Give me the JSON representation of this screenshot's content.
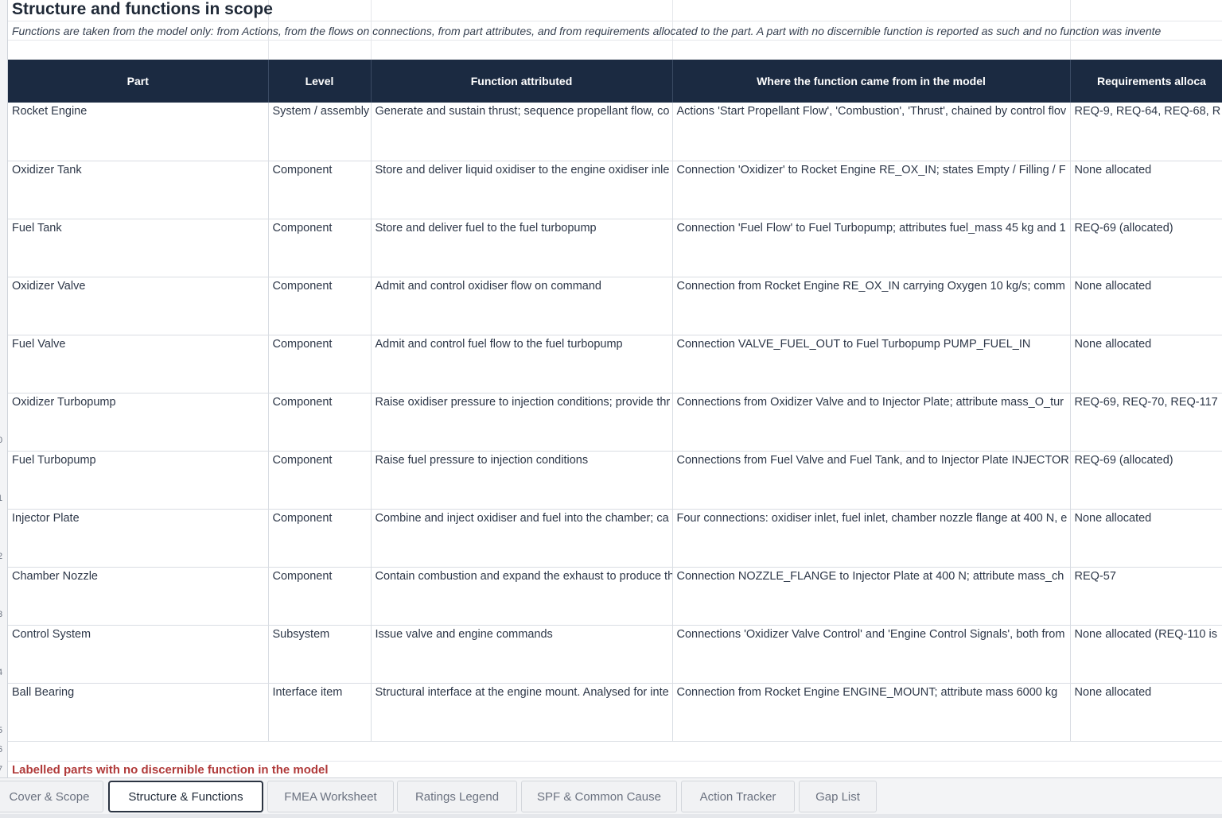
{
  "sheet": {
    "title": "Structure and functions in scope",
    "subtitle": "Functions are taken from the model only: from Actions, from the flows on connections, from part attributes, and from requirements allocated to the part. A part with no discernible function is reported as such and no function was invente",
    "row_numbers": [
      "0",
      "1",
      "2",
      "3",
      "4",
      "5",
      "6",
      "7"
    ],
    "columns": [
      "Part",
      "Level",
      "Function attributed",
      "Where the function came from in the model",
      "Requirements alloca"
    ],
    "rows": [
      [
        "Rocket Engine",
        "System / assembly",
        "Generate and sustain thrust; sequence propellant flow, co",
        "Actions 'Start Propellant Flow', 'Combustion', 'Thrust', chained by control flov",
        "REQ-9, REQ-64, REQ-68, R"
      ],
      [
        "Oxidizer Tank",
        "Component",
        "Store and deliver liquid oxidiser to the engine oxidiser inle",
        "Connection 'Oxidizer' to Rocket Engine RE_OX_IN; states Empty / Filling / F",
        "None allocated"
      ],
      [
        "Fuel Tank",
        "Component",
        "Store and deliver fuel to the fuel turbopump",
        "Connection 'Fuel Flow' to Fuel Turbopump; attributes fuel_mass 45 kg and 1",
        "REQ-69 (allocated)"
      ],
      [
        "Oxidizer Valve",
        "Component",
        "Admit and control oxidiser flow on command",
        "Connection from Rocket Engine RE_OX_IN carrying Oxygen 10 kg/s; comm",
        "None allocated"
      ],
      [
        "Fuel Valve",
        "Component",
        "Admit and control fuel flow to the fuel turbopump",
        "Connection VALVE_FUEL_OUT to Fuel Turbopump PUMP_FUEL_IN",
        "None allocated"
      ],
      [
        "Oxidizer Turbopump",
        "Component",
        "Raise oxidiser pressure to injection conditions; provide thr",
        "Connections from Oxidizer Valve and to Injector Plate; attribute mass_O_tur",
        "REQ-69, REQ-70, REQ-117"
      ],
      [
        "Fuel Turbopump",
        "Component",
        "Raise fuel pressure to injection conditions",
        "Connections from Fuel Valve and Fuel Tank, and to Injector Plate INJECTOR",
        "REQ-69 (allocated)"
      ],
      [
        "Injector Plate",
        "Component",
        "Combine and inject oxidiser and fuel into the chamber; ca",
        "Four connections: oxidiser inlet, fuel inlet, chamber nozzle flange at 400 N, e",
        "None allocated"
      ],
      [
        "Chamber Nozzle",
        "Component",
        "Contain combustion and expand the exhaust to produce th",
        "Connection NOZZLE_FLANGE to Injector Plate at 400 N; attribute mass_ch",
        "REQ-57"
      ],
      [
        "Control System",
        "Subsystem",
        "Issue valve and engine commands",
        "Connections 'Oxidizer Valve Control' and 'Engine Control Signals', both from",
        "None allocated (REQ-110 is"
      ],
      [
        "Ball Bearing",
        "Interface item",
        "Structural interface at the engine mount. Analysed for inte",
        "Connection from Rocket Engine ENGINE_MOUNT; attribute mass 6000 kg",
        "None allocated"
      ]
    ],
    "section_heading": "Labelled parts with no discernible function in the model"
  },
  "tabs": [
    {
      "label": "Cover & Scope",
      "active": false
    },
    {
      "label": "Structure & Functions",
      "active": true
    },
    {
      "label": "FMEA Worksheet",
      "active": false
    },
    {
      "label": "Ratings Legend",
      "active": false
    },
    {
      "label": "SPF & Common Cause",
      "active": false
    },
    {
      "label": "Action Tracker",
      "active": false
    },
    {
      "label": "Gap List",
      "active": false
    }
  ],
  "colors": {
    "header_bg": "#1b2a41",
    "header_text": "#ffffff",
    "section_heading": "#b03a3a",
    "active_tab_border": "#2b3442"
  }
}
